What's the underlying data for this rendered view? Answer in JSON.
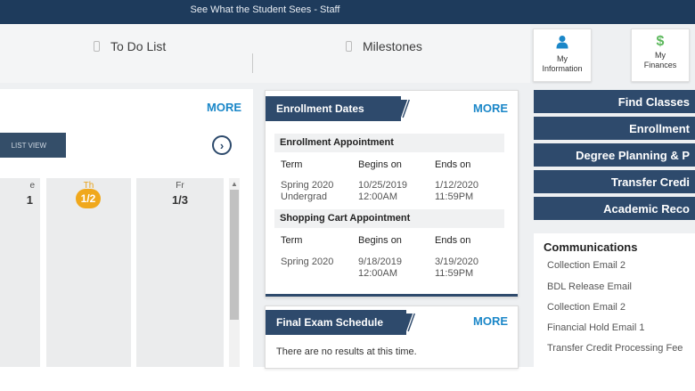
{
  "banner": {
    "title": "See What the Student Sees - Staff"
  },
  "tabs": {
    "todo_label": "To Do List",
    "milestones_label": "Milestones"
  },
  "tiles": [
    {
      "label_line1": "My",
      "label_line2": "Information",
      "icon": "person-icon"
    },
    {
      "label_line1": "My",
      "label_line2": "Finances",
      "icon": "dollar-icon"
    }
  ],
  "calendar": {
    "more_label": "MORE",
    "list_view_label": "LIST VIEW",
    "days": [
      {
        "name": "e",
        "number": "1"
      },
      {
        "name": "Th",
        "number": "1/2",
        "today": true
      },
      {
        "name": "Fr",
        "number": "1/3"
      }
    ]
  },
  "enrollment": {
    "title": "Enrollment Dates",
    "more_label": "MORE",
    "sections": [
      {
        "title": "Enrollment Appointment",
        "headers": [
          "Term",
          "Begins on",
          "Ends on"
        ],
        "row": {
          "term1": "Spring 2020",
          "term2": "Undergrad",
          "begins1": "10/25/2019",
          "begins2": "12:00AM",
          "ends1": "1/12/2020",
          "ends2": "11:59PM"
        }
      },
      {
        "title": "Shopping Cart Appointment",
        "headers": [
          "Term",
          "Begins on",
          "Ends on"
        ],
        "row": {
          "term1": "Spring 2020",
          "term2": "",
          "begins1": "9/18/2019",
          "begins2": "12:00AM",
          "ends1": "3/19/2020",
          "ends2": "11:59PM"
        }
      }
    ]
  },
  "final_exam": {
    "title": "Final Exam Schedule",
    "more_label": "MORE",
    "message": "There are no results at this time."
  },
  "right_nav": [
    "Find Classes",
    "Enrollment",
    "Degree Planning & P",
    "Transfer Credi",
    "Academic Reco"
  ],
  "communications": {
    "title": "Communications",
    "items": [
      "Collection Email 2",
      "BDL Release Email",
      "Collection Email 2",
      "Financial Hold Email 1",
      "Transfer Credit Processing Fee"
    ]
  },
  "colors": {
    "banner": "#1e3b5c",
    "navy": "#2e4a6c",
    "link": "#1b87c8",
    "today": "#f0a81c",
    "dollar": "#5cb85c",
    "person": "#1b87c8"
  }
}
